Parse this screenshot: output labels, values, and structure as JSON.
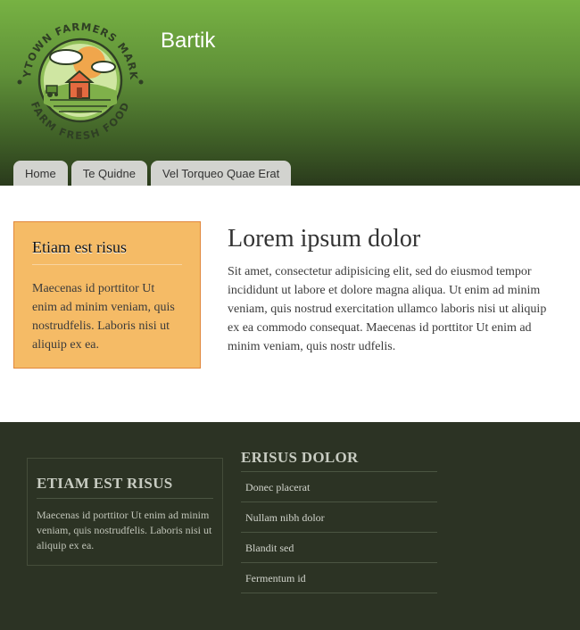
{
  "header": {
    "site_name": "Bartik",
    "logo": {
      "top_text": "ANYTOWN FARMERS MARKET",
      "bottom_text": "FARM FRESH FOOD"
    },
    "tabs": [
      {
        "label": "Home"
      },
      {
        "label": "Te Quidne"
      },
      {
        "label": "Vel Torqueo Quae Erat"
      }
    ]
  },
  "sidebar": {
    "title": "Etiam est risus",
    "body": "Maecenas id porttitor Ut enim ad minim veniam, quis nostrudfelis. Laboris nisi ut aliquip ex ea."
  },
  "main": {
    "title": "Lorem ipsum dolor",
    "body": "Sit amet, consectetur adipisicing elit, sed do eiusmod tempor incididunt ut labore et dolore magna aliqua. Ut enim ad minim veniam, quis nostrud exercitation ullamco laboris nisi ut aliquip ex ea commodo consequat. Maecenas id porttitor Ut enim ad minim veniam, quis nostr udfelis."
  },
  "footer": {
    "block": {
      "title": "ETIAM EST RISUS",
      "body": "Maecenas id porttitor Ut enim ad minim veniam, quis nostrudfelis. Laboris nisi ut aliquip ex ea."
    },
    "menu": {
      "title": "ERISUS DOLOR",
      "items": [
        {
          "label": "Donec placerat"
        },
        {
          "label": "Nullam nibh dolor"
        },
        {
          "label": "Blandit sed"
        },
        {
          "label": "Fermentum id"
        }
      ]
    }
  },
  "colors": {
    "header_top": "#77b243",
    "header_bottom": "#2a3a1c",
    "sidebar_bg": "#f5bb66",
    "footer_bg": "#2c3324",
    "tab_bg": "#d2d3cf"
  }
}
